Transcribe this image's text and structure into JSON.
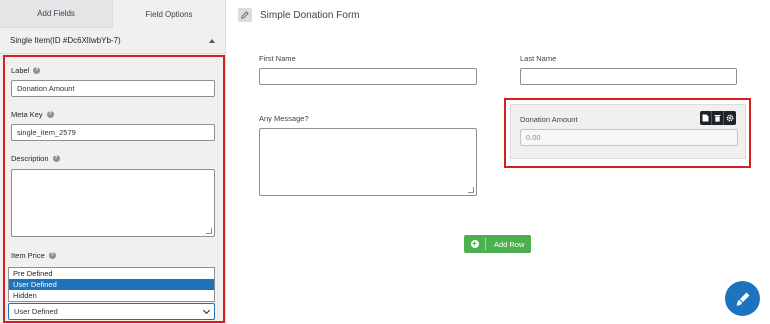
{
  "sidebar": {
    "tabs": [
      {
        "label": "Add Fields"
      },
      {
        "label": "Field Options"
      }
    ],
    "section_title": "Single Item(ID #Dc6XlIwbYb-7)",
    "fields": {
      "label": {
        "title": "Label",
        "value": "Donation Amount"
      },
      "meta_key": {
        "title": "Meta Key",
        "value": "single_item_2579"
      },
      "description": {
        "title": "Description",
        "value": ""
      },
      "item_price": {
        "title": "Item Price",
        "options": [
          "Pre Defined",
          "User Defined",
          "Hidden"
        ],
        "highlighted": "User Defined",
        "selected": "User Defined"
      }
    }
  },
  "form": {
    "title": "Simple Donation Form",
    "fields": {
      "first_name": "First Name",
      "last_name": "Last Name",
      "message": "Any Message?",
      "donation_label": "Donation Amount",
      "donation_placeholder": "0.00"
    },
    "add_row_label": "Add Row"
  },
  "colors": {
    "highlight": "#d91e1e",
    "add_row": "#4caf50",
    "fab": "#1e73be",
    "option_selected": "#1e73be"
  }
}
